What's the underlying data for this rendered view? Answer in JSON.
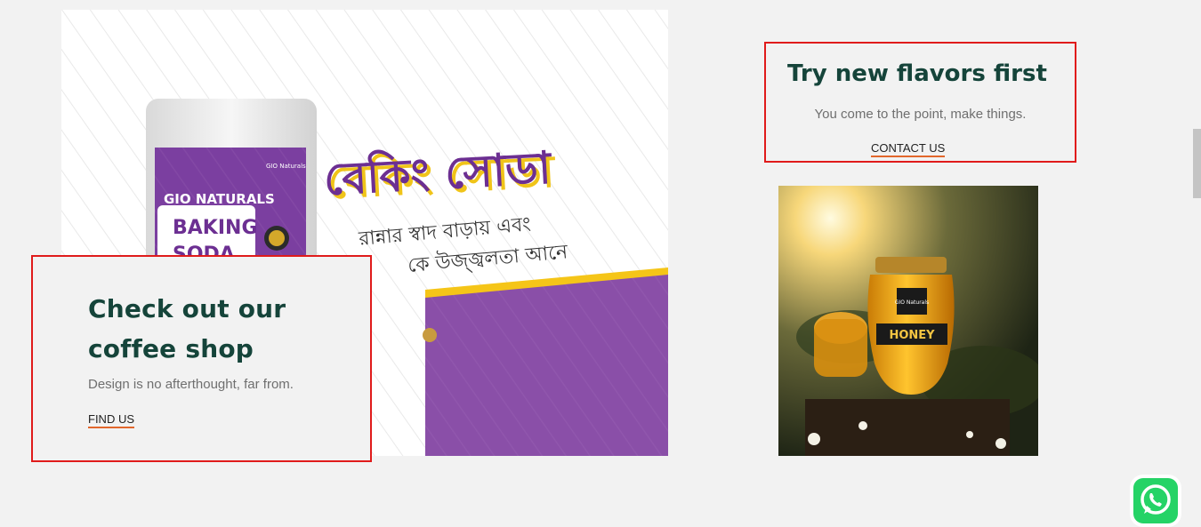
{
  "banner": {
    "product_brand": "GIO NATURALS",
    "product_name_1": "BAKING",
    "product_name_2": "SODA",
    "logo_text": "GIO Naturals",
    "headline_bn": "বেকিং সোডা",
    "tagline_bn_1": "রান্নার স্বাদ বাড়ায় এবং",
    "tagline_bn_2": "কে উজ্জ্বলতা আনে"
  },
  "coffee": {
    "title": "Check out our coffee shop",
    "subtitle": "Design is no afterthought, far from.",
    "link": "FIND US"
  },
  "flavors": {
    "title": "Try new flavors first",
    "subtitle": "You come to the point, make things.",
    "link": "CONTACT US"
  },
  "honey": {
    "label": "HONEY",
    "brand": "GIO Naturals"
  },
  "colors": {
    "title_green": "#15443a",
    "link_underline": "#e2672c",
    "highlight_border": "#e01b1b",
    "banner_purple": "#8a4fa8",
    "whatsapp": "#25d366"
  },
  "icons": [
    "whatsapp-icon"
  ]
}
